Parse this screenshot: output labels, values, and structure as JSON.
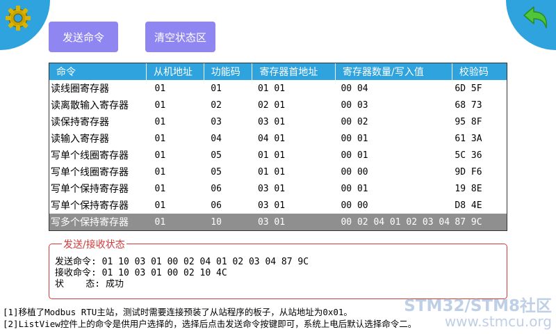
{
  "buttons": {
    "send": "发送命令",
    "clear": "清空状态区"
  },
  "table": {
    "headers": [
      "命令",
      "从机地址",
      "功能码",
      "寄存器首地址",
      "寄存器数量/写入值",
      "校验码"
    ],
    "rows": [
      [
        "读线圈寄存器",
        "01",
        "01",
        "01 01",
        "00 04",
        "6D 5F"
      ],
      [
        "读离散输入寄存器",
        "01",
        "02",
        "02 01",
        "00 03",
        "68 73"
      ],
      [
        "读保持寄存器",
        "01",
        "03",
        "03 01",
        "00 02",
        "95 8F"
      ],
      [
        "读输入寄存器",
        "01",
        "04",
        "04 01",
        "00 01",
        "61 3A"
      ],
      [
        "写单个线圈寄存器",
        "01",
        "05",
        "01 01",
        "00 01",
        "5C 36"
      ],
      [
        "写单个线圈寄存器",
        "01",
        "05",
        "01 01",
        "00 00",
        "9D F6"
      ],
      [
        "写单个保持寄存器",
        "01",
        "06",
        "03 01",
        "00 01",
        "19 8E"
      ],
      [
        "写单个保持寄存器",
        "01",
        "06",
        "03 01",
        "00 00",
        "D8 4E"
      ],
      [
        "写多个保持寄存器",
        "01",
        "10",
        "03 01",
        "00 02 04 01 02 03 04",
        "87 9C"
      ]
    ],
    "selected_row": 8
  },
  "status": {
    "title": "发送/接收状态",
    "send_line": "发送命令: 01 10 03 01 00 02 04 01 02 03 04 87 9C",
    "recv_line": "接收命令: 01 10 03 01 00 02 10 4C",
    "state_line": "状    态: 成功"
  },
  "notes": {
    "line1": "[1]移植了Modbus RTU主站，测试时需要连接预装了从站程序的板子，从站地址为0x01。",
    "line2": "[2]ListView控件上的命令是供用户选择的，选择后点击发送命令按键即可，系统上电后默认选择命令二。"
  },
  "watermark": {
    "line1": "STM32/STM8社区",
    "line2": "www.stmcu.org"
  },
  "icons": {
    "settings": "gear-icon",
    "back": "back-arrow-icon"
  },
  "colors": {
    "accent": "#2ea3de",
    "button": "#8f86f2",
    "selected_row": "#8f8f8f",
    "status_border": "#d23a3a",
    "watermark": "#bfcfe6"
  }
}
